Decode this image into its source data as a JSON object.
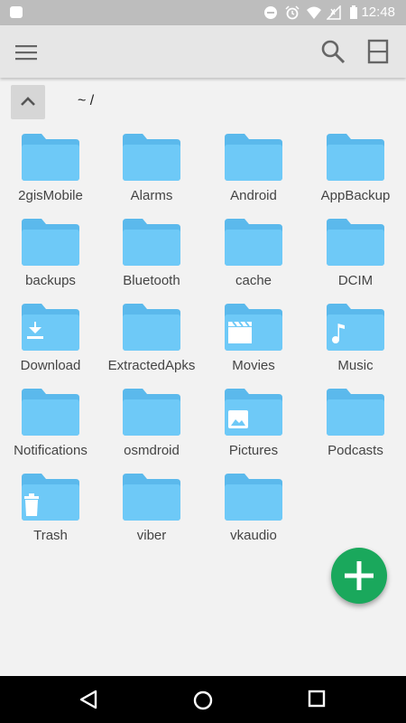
{
  "status_bar": {
    "time": "12:48"
  },
  "path_bar": {
    "path": "~ /"
  },
  "folders": [
    {
      "name": "2gisMobile",
      "icon": "folder-icon"
    },
    {
      "name": "Alarms",
      "icon": "folder-icon"
    },
    {
      "name": "Android",
      "icon": "folder-icon"
    },
    {
      "name": "AppBackup",
      "icon": "folder-icon"
    },
    {
      "name": "backups",
      "icon": "folder-icon"
    },
    {
      "name": "Bluetooth",
      "icon": "folder-icon"
    },
    {
      "name": "cache",
      "icon": "folder-icon"
    },
    {
      "name": "DCIM",
      "icon": "folder-icon"
    },
    {
      "name": "Download",
      "icon": "download-folder-icon"
    },
    {
      "name": "ExtractedApks",
      "icon": "folder-icon"
    },
    {
      "name": "Movies",
      "icon": "movies-folder-icon"
    },
    {
      "name": "Music",
      "icon": "music-folder-icon"
    },
    {
      "name": "Notifications",
      "icon": "folder-icon"
    },
    {
      "name": "osmdroid",
      "icon": "folder-icon"
    },
    {
      "name": "Pictures",
      "icon": "pictures-folder-icon"
    },
    {
      "name": "Podcasts",
      "icon": "folder-icon"
    },
    {
      "name": "Trash",
      "icon": "trash-folder-icon"
    },
    {
      "name": "viber",
      "icon": "folder-icon"
    },
    {
      "name": "vkaudio",
      "icon": "folder-icon"
    }
  ],
  "colors": {
    "folder": "#6ec9f7",
    "folder_tab": "#5bb9ec",
    "fab": "#1aa85c",
    "app_bar": "#e6e6e6"
  }
}
